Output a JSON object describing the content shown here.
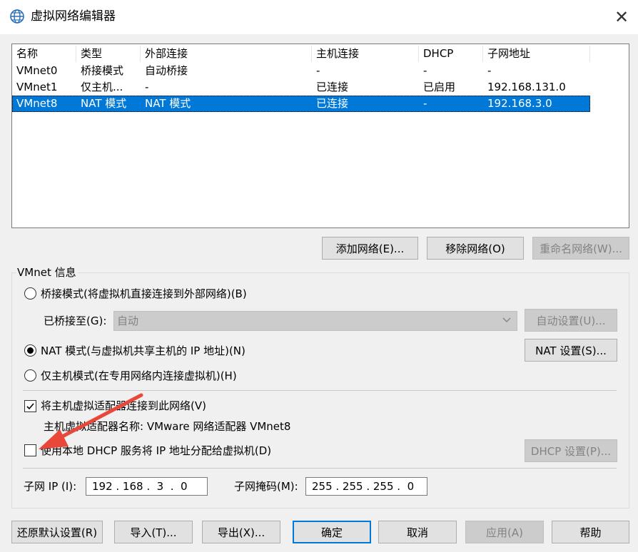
{
  "window": {
    "title": "虚拟网络编辑器",
    "icon": "globe-icon",
    "close_glyph": "✕"
  },
  "list": {
    "columns": [
      "名称",
      "类型",
      "外部连接",
      "主机连接",
      "DHCP",
      "子网地址"
    ],
    "rows": [
      {
        "name": "VMnet0",
        "type": "桥接模式",
        "external": "自动桥接",
        "host": "-",
        "dhcp": "-",
        "subnet": "-"
      },
      {
        "name": "VMnet1",
        "type": "仅主机...",
        "external": "-",
        "host": "已连接",
        "dhcp": "已启用",
        "subnet": "192.168.131.0"
      },
      {
        "name": "VMnet8",
        "type": "NAT 模式",
        "external": "NAT 模式",
        "host": "已连接",
        "dhcp": "-",
        "subnet": "192.168.3.0"
      }
    ],
    "selected_index": 2
  },
  "list_buttons": {
    "add": "添加网络(E)...",
    "remove": "移除网络(O)",
    "rename": "重命名网络(W)..."
  },
  "vmnet_info": {
    "group_label": "VMnet 信息",
    "bridged_label": "桥接模式(将虚拟机直接连接到外部网络)(B)",
    "bridged_to_label": "已桥接至(G):",
    "bridged_to_value": "自动",
    "auto_settings": "自动设置(U)...",
    "nat_label": "NAT 模式(与虚拟机共享主机的 IP 地址)(N)",
    "nat_settings": "NAT 设置(S)...",
    "hostonly_label": "仅主机模式(在专用网络内连接虚拟机)(H)",
    "connect_adapter_label": "将主机虚拟适配器连接到此网络(V)",
    "adapter_name_label": "主机虚拟适配器名称: VMware 网络适配器 VMnet8",
    "dhcp_label": "使用本地 DHCP 服务将 IP 地址分配给虚拟机(D)",
    "dhcp_settings": "DHCP 设置(P)...",
    "subnet_ip_label": "子网 IP (I):",
    "subnet_ip_value": "192 . 168 .  3  .  0",
    "subnet_mask_label": "子网掩码(M):",
    "subnet_mask_value": "255 . 255 . 255 .  0",
    "connect_adapter_checked": true,
    "dhcp_checked": false
  },
  "bottom_buttons": {
    "restore": "还原默认设置(R)",
    "import": "导入(T)...",
    "export": "导出(X)...",
    "ok": "确定",
    "cancel": "取消",
    "apply": "应用(A)",
    "help": "帮助"
  },
  "colors": {
    "selection": "#0078d7",
    "annotation_arrow": "#e8473a"
  }
}
